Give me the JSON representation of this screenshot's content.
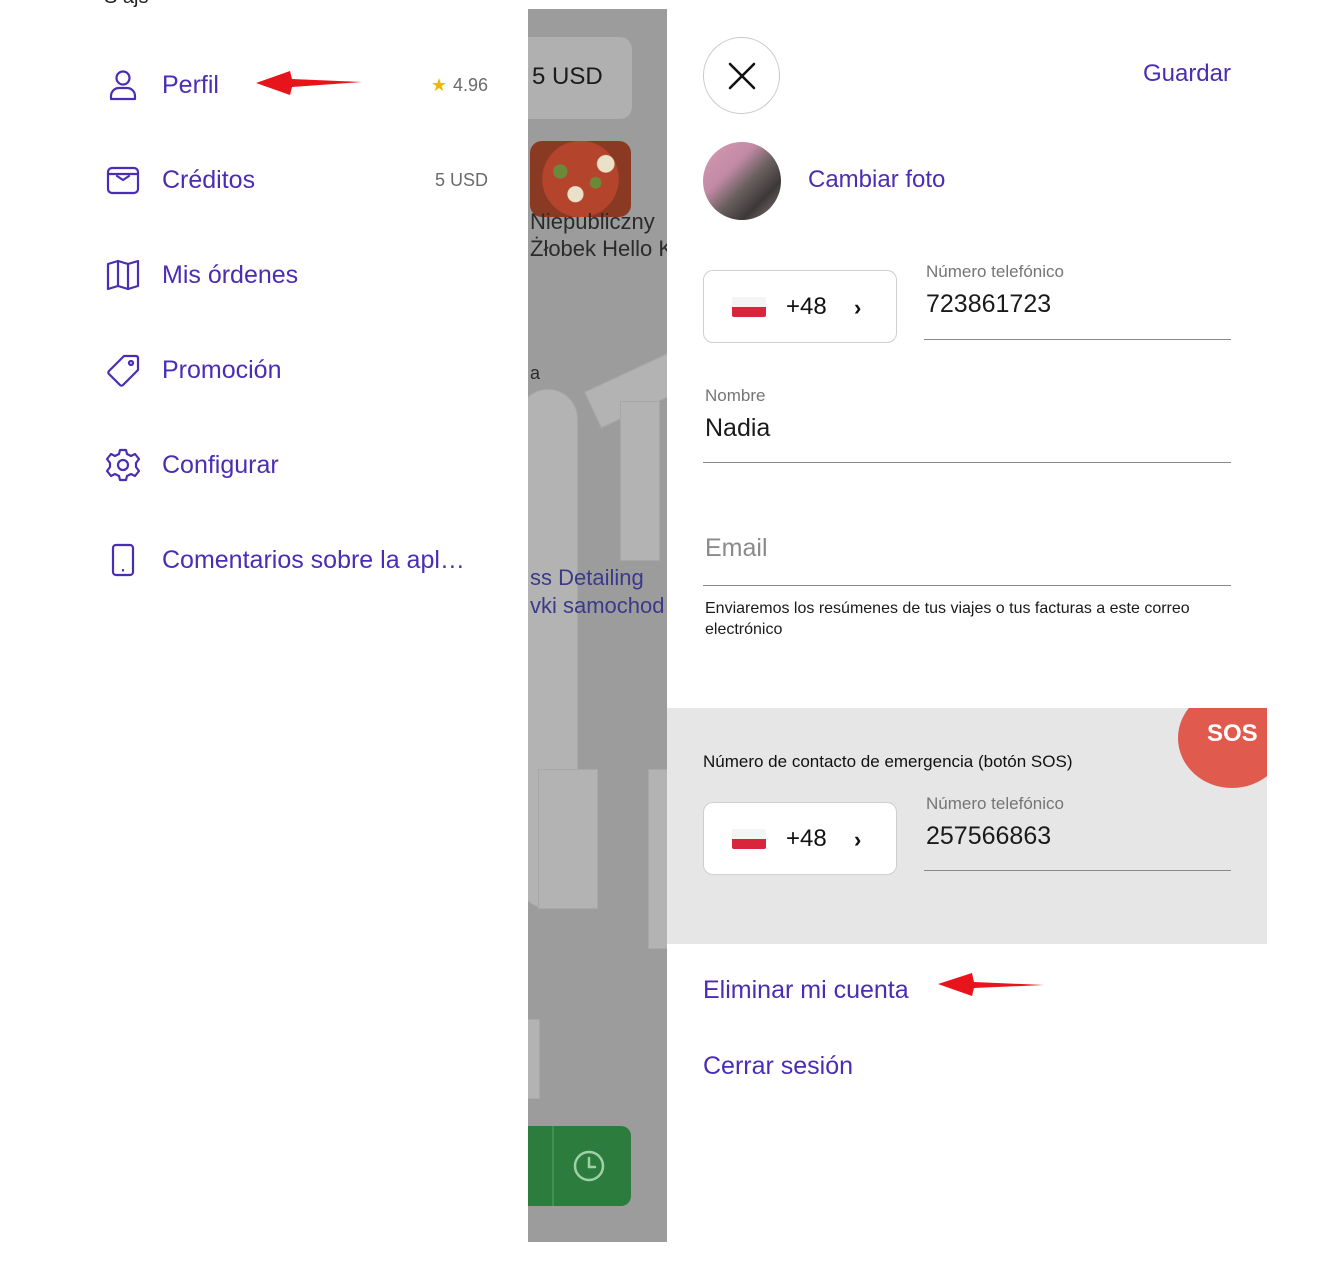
{
  "drawer": {
    "top_fragment": "Ś                      ajś",
    "items": [
      {
        "label": "Perfil",
        "icon": "user-icon",
        "meta": "4.96"
      },
      {
        "label": "Créditos",
        "icon": "wallet-icon",
        "meta": "5 USD"
      },
      {
        "label": "Mis órdenes",
        "icon": "book-icon",
        "meta": ""
      },
      {
        "label": "Promoción",
        "icon": "tag-icon",
        "meta": ""
      },
      {
        "label": "Configurar",
        "icon": "gear-icon",
        "meta": ""
      },
      {
        "label": "Comentarios sobre la apl…",
        "icon": "phone-icon",
        "meta": ""
      }
    ]
  },
  "map_strip": {
    "balance": "5 USD",
    "place_name_line1": "Niepubliczny",
    "place_name_line2": "Żłobek Hello K",
    "street_letter": "a",
    "business_line1": "ss Detailing",
    "business_line2": "vki samochod"
  },
  "profile": {
    "save_label": "Guardar",
    "change_photo_label": "Cambiar foto",
    "phone": {
      "country_code": "+48",
      "label": "Número telefónico",
      "value": "723861723"
    },
    "name": {
      "label": "Nombre",
      "value": "Nadia"
    },
    "email": {
      "placeholder": "Email",
      "helper": "Enviaremos los resúmenes de tus viajes o tus facturas a este correo electrónico"
    },
    "emergency": {
      "title": "Número de contacto de emergencia (botón SOS)",
      "country_code": "+48",
      "label": "Número telefónico",
      "value": "257566863",
      "sos_label": "SOS"
    },
    "delete_account_label": "Eliminar mi cuenta",
    "logout_label": "Cerrar sesión"
  },
  "colors": {
    "accent": "#4a2db5",
    "rating_star": "#f5b400",
    "sos": "#e15a4e",
    "annotation_arrow": "#e8141b",
    "emergency_bg": "#e6e6e6"
  }
}
